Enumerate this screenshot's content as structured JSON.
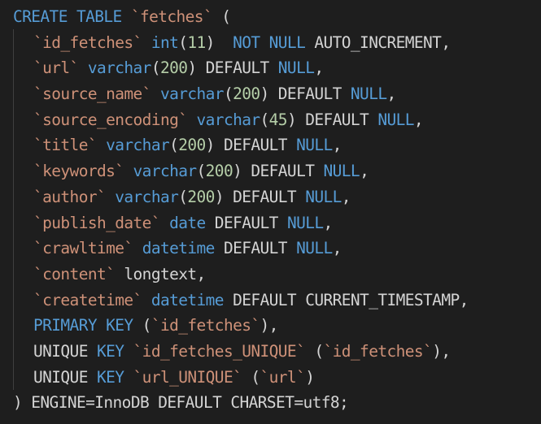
{
  "lines": [
    {
      "indent": 0,
      "tokens": [
        {
          "t": "CREATE TABLE ",
          "c": "kw"
        },
        {
          "t": "`fetches`",
          "c": "str"
        },
        {
          "t": " (",
          "c": "punc"
        }
      ]
    },
    {
      "indent": 1,
      "tokens": [
        {
          "t": "`id_fetches`",
          "c": "str"
        },
        {
          "t": " ",
          "c": "pl"
        },
        {
          "t": "int",
          "c": "ty"
        },
        {
          "t": "(",
          "c": "punc"
        },
        {
          "t": "11",
          "c": "num"
        },
        {
          "t": ")  ",
          "c": "punc"
        },
        {
          "t": "NOT NULL",
          "c": "kw"
        },
        {
          "t": " AUTO_INCREMENT,",
          "c": "pl"
        }
      ]
    },
    {
      "indent": 1,
      "tokens": [
        {
          "t": "`url`",
          "c": "str"
        },
        {
          "t": " ",
          "c": "pl"
        },
        {
          "t": "varchar",
          "c": "ty"
        },
        {
          "t": "(",
          "c": "punc"
        },
        {
          "t": "200",
          "c": "num"
        },
        {
          "t": ") DEFAULT ",
          "c": "pl"
        },
        {
          "t": "NULL",
          "c": "kw"
        },
        {
          "t": ",",
          "c": "punc"
        }
      ]
    },
    {
      "indent": 1,
      "tokens": [
        {
          "t": "`source_name`",
          "c": "str"
        },
        {
          "t": " ",
          "c": "pl"
        },
        {
          "t": "varchar",
          "c": "ty"
        },
        {
          "t": "(",
          "c": "punc"
        },
        {
          "t": "200",
          "c": "num"
        },
        {
          "t": ") DEFAULT ",
          "c": "pl"
        },
        {
          "t": "NULL",
          "c": "kw"
        },
        {
          "t": ",",
          "c": "punc"
        }
      ]
    },
    {
      "indent": 1,
      "tokens": [
        {
          "t": "`source_encoding`",
          "c": "str"
        },
        {
          "t": " ",
          "c": "pl"
        },
        {
          "t": "varchar",
          "c": "ty"
        },
        {
          "t": "(",
          "c": "punc"
        },
        {
          "t": "45",
          "c": "num"
        },
        {
          "t": ") DEFAULT ",
          "c": "pl"
        },
        {
          "t": "NULL",
          "c": "kw"
        },
        {
          "t": ",",
          "c": "punc"
        }
      ]
    },
    {
      "indent": 1,
      "tokens": [
        {
          "t": "`title`",
          "c": "str"
        },
        {
          "t": " ",
          "c": "pl"
        },
        {
          "t": "varchar",
          "c": "ty"
        },
        {
          "t": "(",
          "c": "punc"
        },
        {
          "t": "200",
          "c": "num"
        },
        {
          "t": ") DEFAULT ",
          "c": "pl"
        },
        {
          "t": "NULL",
          "c": "kw"
        },
        {
          "t": ",",
          "c": "punc"
        }
      ]
    },
    {
      "indent": 1,
      "tokens": [
        {
          "t": "`keywords`",
          "c": "str"
        },
        {
          "t": " ",
          "c": "pl"
        },
        {
          "t": "varchar",
          "c": "ty"
        },
        {
          "t": "(",
          "c": "punc"
        },
        {
          "t": "200",
          "c": "num"
        },
        {
          "t": ") DEFAULT ",
          "c": "pl"
        },
        {
          "t": "NULL",
          "c": "kw"
        },
        {
          "t": ",",
          "c": "punc"
        }
      ]
    },
    {
      "indent": 1,
      "tokens": [
        {
          "t": "`author`",
          "c": "str"
        },
        {
          "t": " ",
          "c": "pl"
        },
        {
          "t": "varchar",
          "c": "ty"
        },
        {
          "t": "(",
          "c": "punc"
        },
        {
          "t": "200",
          "c": "num"
        },
        {
          "t": ") DEFAULT ",
          "c": "pl"
        },
        {
          "t": "NULL",
          "c": "kw"
        },
        {
          "t": ",",
          "c": "punc"
        }
      ]
    },
    {
      "indent": 1,
      "tokens": [
        {
          "t": "`publish_date`",
          "c": "str"
        },
        {
          "t": " ",
          "c": "pl"
        },
        {
          "t": "date",
          "c": "ty"
        },
        {
          "t": " DEFAULT ",
          "c": "pl"
        },
        {
          "t": "NULL",
          "c": "kw"
        },
        {
          "t": ",",
          "c": "punc"
        }
      ]
    },
    {
      "indent": 1,
      "tokens": [
        {
          "t": "`crawltime`",
          "c": "str"
        },
        {
          "t": " ",
          "c": "pl"
        },
        {
          "t": "datetime",
          "c": "ty"
        },
        {
          "t": " DEFAULT ",
          "c": "pl"
        },
        {
          "t": "NULL",
          "c": "kw"
        },
        {
          "t": ",",
          "c": "punc"
        }
      ]
    },
    {
      "indent": 1,
      "tokens": [
        {
          "t": "`content`",
          "c": "str"
        },
        {
          "t": " longtext,",
          "c": "pl"
        }
      ]
    },
    {
      "indent": 1,
      "tokens": [
        {
          "t": "`createtime`",
          "c": "str"
        },
        {
          "t": " ",
          "c": "pl"
        },
        {
          "t": "datetime",
          "c": "ty"
        },
        {
          "t": " DEFAULT CURRENT_TIMESTAMP,",
          "c": "pl"
        }
      ]
    },
    {
      "indent": 1,
      "tokens": [
        {
          "t": "PRIMARY KEY",
          "c": "kw"
        },
        {
          "t": " (",
          "c": "punc"
        },
        {
          "t": "`id_fetches`",
          "c": "str"
        },
        {
          "t": "),",
          "c": "punc"
        }
      ]
    },
    {
      "indent": 1,
      "tokens": [
        {
          "t": "UNIQUE ",
          "c": "pl"
        },
        {
          "t": "KEY",
          "c": "kw"
        },
        {
          "t": " ",
          "c": "pl"
        },
        {
          "t": "`id_fetches_UNIQUE`",
          "c": "str"
        },
        {
          "t": " (",
          "c": "punc"
        },
        {
          "t": "`id_fetches`",
          "c": "str"
        },
        {
          "t": "),",
          "c": "punc"
        }
      ]
    },
    {
      "indent": 1,
      "tokens": [
        {
          "t": "UNIQUE ",
          "c": "pl"
        },
        {
          "t": "KEY",
          "c": "kw"
        },
        {
          "t": " ",
          "c": "pl"
        },
        {
          "t": "`url_UNIQUE`",
          "c": "str"
        },
        {
          "t": " (",
          "c": "punc"
        },
        {
          "t": "`url`",
          "c": "str"
        },
        {
          "t": ")",
          "c": "punc"
        }
      ]
    },
    {
      "indent": 0,
      "tokens": [
        {
          "t": ") ENGINE=InnoDB DEFAULT CHARSET=utf8;",
          "c": "pl"
        }
      ]
    }
  ]
}
